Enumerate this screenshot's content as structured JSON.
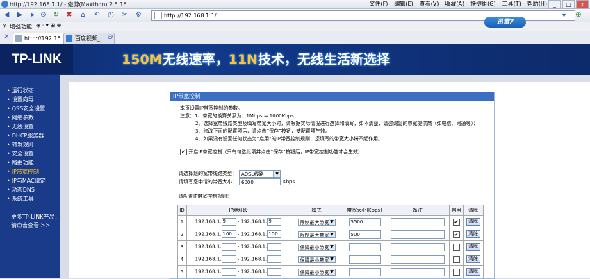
{
  "browser": {
    "title": "http://192.168.1.1/ - 傲游(Maxthon) 2.5.16",
    "menu": [
      "文件(F)",
      "编辑(E)",
      "查看(V)",
      "收藏(A)",
      "快捷组(G)",
      "工具(T)",
      "帮助(H)"
    ],
    "window_buttons": [
      "_",
      "□",
      "x"
    ],
    "address": "http://192.168.1.1/",
    "favorites_label": "增强功能",
    "tabs": [
      "http://192.16...",
      "百度视频_..."
    ],
    "xunlei_label": "迅雷7"
  },
  "banner": {
    "logo": "TP-LINK",
    "slogan_part1": "150M",
    "slogan_part2": "无线速率，",
    "slogan_part3": "11N",
    "slogan_part4": "技术，无线生活新选择"
  },
  "sidebar": {
    "items": [
      "运行状态",
      "设置向导",
      "QSS安全设置",
      "网络参数",
      "无线设置",
      "DHCP服务器",
      "转发规则",
      "安全设置",
      "路由功能",
      "IP带宽控制",
      "IP与MAC绑定",
      "动态DNS",
      "系统工具"
    ],
    "active_index": 9,
    "more_line1": "更多TP-LINK产品，",
    "more_line2": "请点击查看 >>"
  },
  "panel": {
    "title": "IP带宽控制",
    "intro": "本页设置IP带宽控制的参数。",
    "note1": "注意：1、带宽的换算关系为：1Mbps = 1000Kbps；",
    "note2": "2、选择宽带线路类型及填写带宽大小时，请根据实际情况进行选择和填写，如不清楚，请咨询您的带宽提供商（如电信、网通等）；",
    "note3": "3、修改下面的配置项后，请点击“保存”按钮，使配置项生效。",
    "note4": "4、如果没有设置任何状态为“启用”的IP带宽控制规则，您填写的带宽大小将不起作用。",
    "enable_label": "开启IP带宽控制（只有勾选此项并点击“保存”按钮后，IP带宽控制功能才会生效）",
    "enable_checked": true,
    "line_type_label": "请选择您的宽带线路类型：",
    "line_type_value": "ADSL线路",
    "bandwidth_label": "请填写您申请的带宽大小：",
    "bandwidth_value": "6000",
    "bandwidth_unit": "Kbps",
    "rules_label": "请配置IP带宽控制规则："
  },
  "table": {
    "headers": [
      "ID",
      "IP地址段",
      "模式",
      "带宽大小(Kbps)",
      "备注",
      "启用",
      "清除"
    ],
    "ip_prefix": "192.168.1.",
    "dash": "-",
    "clear_label": "清除",
    "rows": [
      {
        "id": "1",
        "start": "9",
        "end": "9",
        "mode": "限制最大带宽",
        "bw": "5500",
        "enabled": true
      },
      {
        "id": "2",
        "start": "100",
        "end": "100",
        "mode": "限制最大带宽",
        "bw": "500",
        "enabled": true
      },
      {
        "id": "3",
        "start": "",
        "end": "",
        "mode": "保障最小带宽",
        "bw": "",
        "enabled": false
      },
      {
        "id": "4",
        "start": "",
        "end": "",
        "mode": "保障最小带宽",
        "bw": "",
        "enabled": false
      },
      {
        "id": "5",
        "start": "",
        "end": "",
        "mode": "保障最小带宽",
        "bw": "",
        "enabled": false
      }
    ]
  }
}
